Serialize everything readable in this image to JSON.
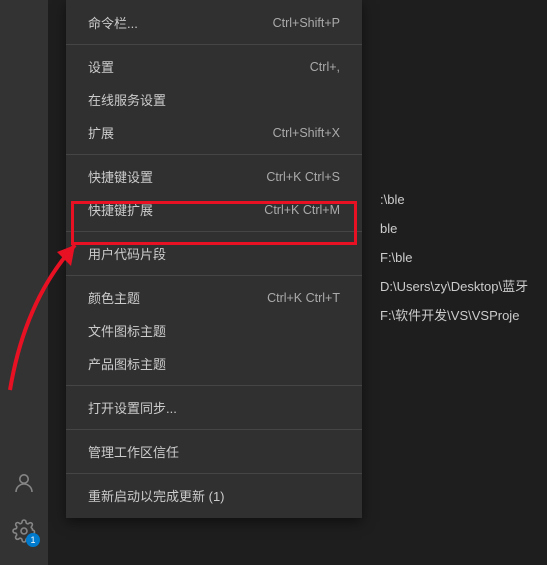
{
  "menu": {
    "items": [
      {
        "label": "命令栏...",
        "shortcut": "Ctrl+Shift+P"
      },
      {
        "sep": true
      },
      {
        "label": "设置",
        "shortcut": "Ctrl+,"
      },
      {
        "label": "在线服务设置",
        "shortcut": ""
      },
      {
        "label": "扩展",
        "shortcut": "Ctrl+Shift+X"
      },
      {
        "sep": true
      },
      {
        "label": "快捷键设置",
        "shortcut": "Ctrl+K Ctrl+S"
      },
      {
        "label": "快捷键扩展",
        "shortcut": "Ctrl+K Ctrl+M"
      },
      {
        "sep": true
      },
      {
        "label": "用户代码片段",
        "shortcut": ""
      },
      {
        "sep": true
      },
      {
        "label": "颜色主题",
        "shortcut": "Ctrl+K Ctrl+T"
      },
      {
        "label": "文件图标主题",
        "shortcut": ""
      },
      {
        "label": "产品图标主题",
        "shortcut": ""
      },
      {
        "sep": true
      },
      {
        "label": "打开设置同步...",
        "shortcut": ""
      },
      {
        "sep": true
      },
      {
        "label": "管理工作区信任",
        "shortcut": ""
      },
      {
        "sep": true
      },
      {
        "label": "重新启动以完成更新 (1)",
        "shortcut": ""
      }
    ]
  },
  "activity": {
    "settings_badge": "1"
  },
  "bg_paths": [
    ":\\ble",
    "ble",
    "F:\\ble",
    "D:\\Users\\zy\\Desktop\\蓝牙",
    "F:\\软件开发\\VS\\VSProje"
  ],
  "annotation": {
    "highlight_color": "#e81123"
  }
}
